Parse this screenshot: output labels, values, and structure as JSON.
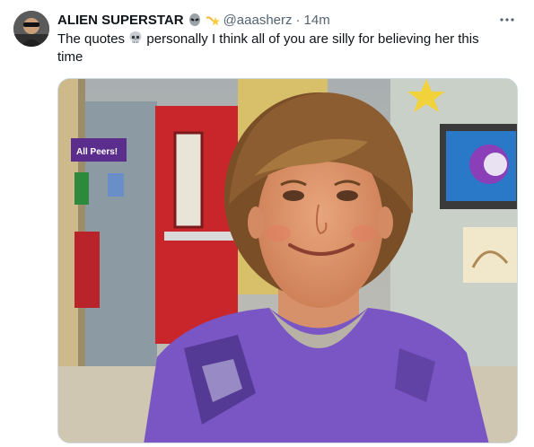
{
  "tweet": {
    "display_name": "ALIEN SUPERSTAR",
    "handle": "@aaasherz",
    "separator": "·",
    "time": "14m",
    "text_before": "The quotes",
    "text_after": "personally I think all of you are silly for believing her this time",
    "icons": {
      "name_emoji_1": "alien-icon",
      "name_emoji_2": "shooting-star-icon",
      "text_emoji": "skull-icon",
      "more": "more-options-icon"
    }
  },
  "media": {
    "sign_text": "All Peers!"
  },
  "colors": {
    "text": "#0f1419",
    "secondary": "#536471",
    "border": "#cfd9de",
    "shirt": "#7a55c4",
    "door": "#c8262a"
  }
}
